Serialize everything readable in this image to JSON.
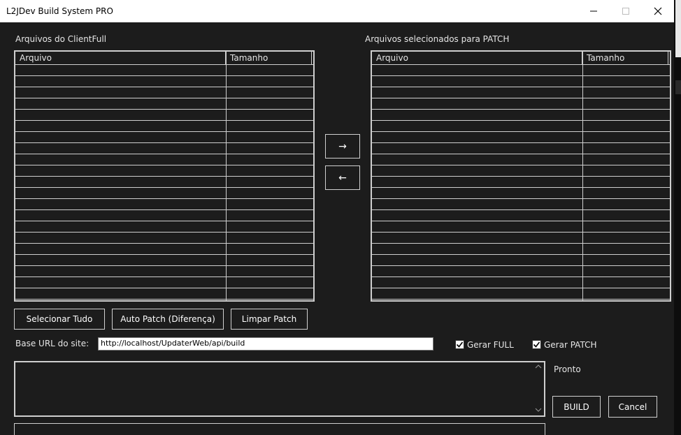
{
  "window": {
    "title": "L2JDev Build System PRO"
  },
  "left_panel": {
    "label": "Arquivos do ClientFull",
    "columns": [
      "Arquivo",
      "Tamanho"
    ]
  },
  "right_panel": {
    "label": "Arquivos selecionados para PATCH",
    "columns": [
      "Arquivo",
      "Tamanho"
    ]
  },
  "transfer": {
    "add": "→",
    "remove": "←"
  },
  "buttons": {
    "select_all": "Selecionar Tudo",
    "auto_patch": "Auto Patch (Diferença)",
    "clear_patch": "Limpar Patch",
    "build": "BUILD",
    "cancel": "Cancel"
  },
  "base_url": {
    "label": "Base URL do site:",
    "value": "http://localhost/UpdaterWeb/api/build"
  },
  "options": {
    "full_label": "Gerar FULL",
    "full_checked": true,
    "patch_label": "Gerar PATCH",
    "patch_checked": true
  },
  "status": {
    "text": "Pronto"
  },
  "icons": {
    "minimize": "minimize-icon",
    "maximize": "maximize-icon",
    "close": "close-icon",
    "check": "check-icon",
    "scroll_up": "scroll-up-icon",
    "scroll_down": "scroll-down-icon"
  }
}
